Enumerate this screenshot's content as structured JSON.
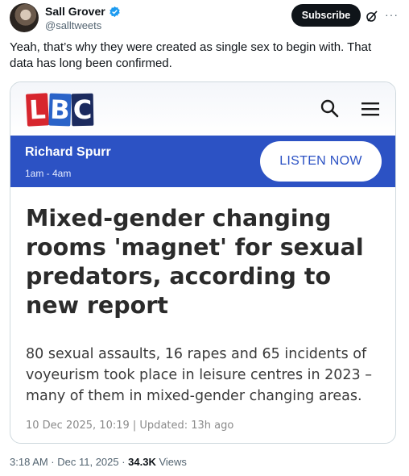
{
  "tweet": {
    "display_name": "Sall Grover",
    "handle": "@salltweets",
    "subscribe_label": "Subscribe",
    "text": "Yeah, that’s why they were created as single sex to begin with. That data has long been confirmed.",
    "timestamp": "3:18 AM · Dec 11, 2025 · ",
    "views_count": "34.3K",
    "views_label": " Views",
    "verified_color": "#1d9bf0"
  },
  "card": {
    "logo_letters": [
      "L",
      "B",
      "C"
    ],
    "radio": {
      "presenter": "Richard Spurr",
      "time": "1am - 4am",
      "listen_label": "LISTEN NOW",
      "bar_color": "#2c52c4"
    },
    "headline": "Mixed-gender changing rooms 'magnet' for sexual predators, according to new report",
    "standfirst": "80 sexual assaults, 16 rapes and 65 incidents of voyeurism took place in leisure centres in 2023 – many of them in mixed-gender changing areas.",
    "dateline": "10 Dec 2025, 10:19 | Updated: 13h ago"
  },
  "icons": {
    "search": "search-icon",
    "menu": "menu-icon",
    "verified": "verified-badge-icon",
    "grok": "grok-icon",
    "more": "more-icon"
  }
}
